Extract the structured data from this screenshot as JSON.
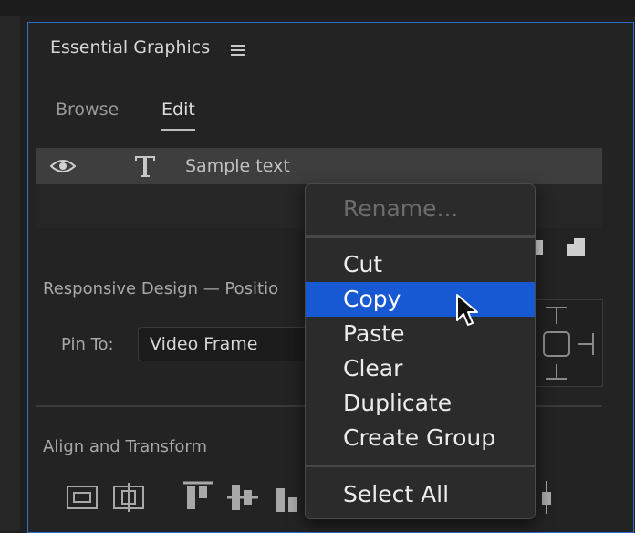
{
  "panel": {
    "title": "Essential Graphics",
    "tabs": [
      {
        "label": "Browse",
        "active": false
      },
      {
        "label": "Edit",
        "active": true
      }
    ]
  },
  "layer": {
    "name": "Sample text",
    "icons": [
      "eye-icon",
      "text-layer-icon"
    ]
  },
  "responsive": {
    "title": "Responsive Design — Positio",
    "pin_label": "Pin To:",
    "pin_value": "Video Frame"
  },
  "align": {
    "title": "Align and Transform"
  },
  "context_menu": {
    "items": [
      {
        "label": "Rename...",
        "enabled": false
      },
      {
        "label": "Cut",
        "enabled": true
      },
      {
        "label": "Copy",
        "enabled": true,
        "selected": true
      },
      {
        "label": "Paste",
        "enabled": true
      },
      {
        "label": "Clear",
        "enabled": true
      },
      {
        "label": "Duplicate",
        "enabled": true
      },
      {
        "label": "Create Group",
        "enabled": true
      },
      {
        "label": "Select All",
        "enabled": true
      }
    ]
  },
  "colors": {
    "accent": "#2f6fcc",
    "selection": "#1759d2"
  }
}
